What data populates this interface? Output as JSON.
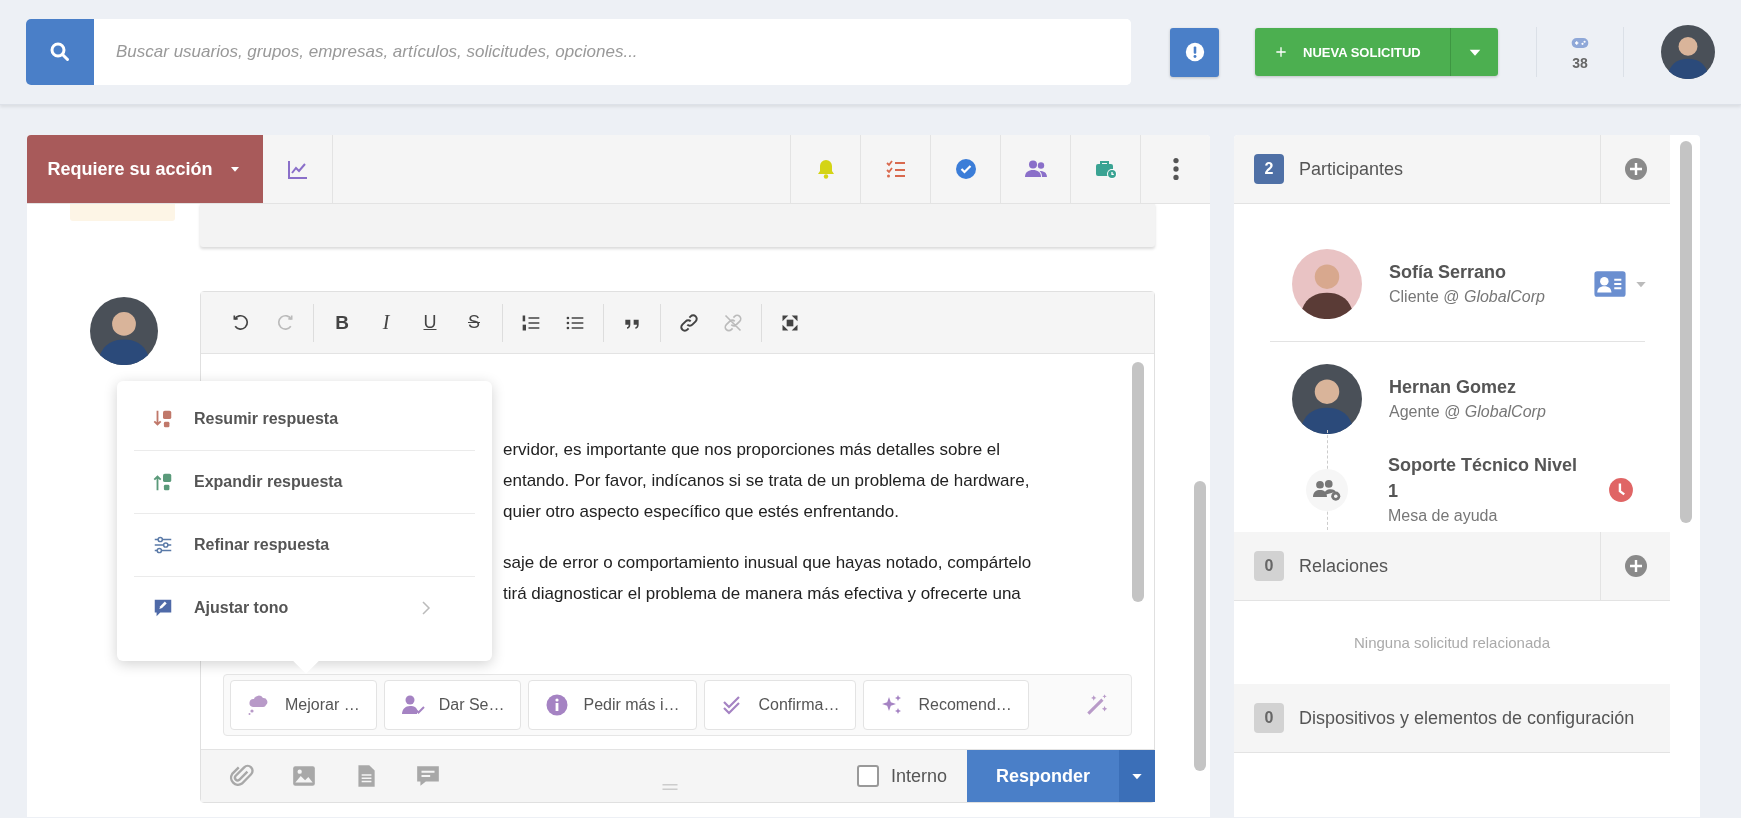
{
  "search": {
    "placeholder": "Buscar usuarios, grupos, empresas, artículos, solicitudes, opciones..."
  },
  "header": {
    "new_request": "NUEVA SOLICITUD",
    "counter": "38"
  },
  "ticket_toolbar": {
    "status": "Requiere su acción"
  },
  "editor": {
    "format_groups": [
      [
        {
          "kind": "undo",
          "disabled": false
        },
        {
          "kind": "redo",
          "disabled": true
        }
      ],
      [
        {
          "kind": "bold",
          "glyph": "B",
          "disabled": false
        },
        {
          "kind": "italic",
          "glyph": "I",
          "disabled": false
        },
        {
          "kind": "underline",
          "glyph": "U",
          "disabled": false
        },
        {
          "kind": "strike",
          "glyph": "S",
          "disabled": false
        }
      ],
      [
        {
          "kind": "ordered-list",
          "disabled": false
        },
        {
          "kind": "bullet-list",
          "disabled": false
        }
      ],
      [
        {
          "kind": "quote",
          "disabled": false
        }
      ],
      [
        {
          "kind": "link",
          "disabled": false
        },
        {
          "kind": "unlink",
          "disabled": true
        }
      ],
      [
        {
          "kind": "fullscreen",
          "disabled": false
        }
      ]
    ],
    "paragraphs": [
      [
        "ervidor, es importante que nos proporciones más detalles sobre el",
        "entando. Por favor, indícanos si se trata de un problema de hardware,",
        "quier otro aspecto específico que estés enfrentando."
      ],
      [
        "saje de error o comportamiento inusual que hayas notado, compártelo",
        "tirá diagnosticar el problema de manera más efectiva y ofrecerte una"
      ]
    ],
    "suggestions": [
      {
        "kind": "improve",
        "label": "Mejorar …"
      },
      {
        "kind": "follow-up",
        "label": "Dar Se…"
      },
      {
        "kind": "info",
        "label": "Pedir más i…"
      },
      {
        "kind": "confirm",
        "label": "Confirma…"
      },
      {
        "kind": "recommend",
        "label": "Recomend…"
      }
    ],
    "internal": {
      "label": "Interno",
      "checked": false
    },
    "send": "Responder"
  },
  "popup_menu": {
    "items": [
      {
        "kind": "summarize",
        "label": "Resumir respuesta",
        "submenu": false
      },
      {
        "kind": "expand",
        "label": "Expandir respuesta",
        "submenu": false
      },
      {
        "kind": "refine",
        "label": "Refinar respuesta",
        "submenu": false
      },
      {
        "kind": "tone",
        "label": "Ajustar tono",
        "submenu": true
      }
    ]
  },
  "sidebar": {
    "participants": {
      "count": "2",
      "color": "#4f70a6",
      "title": "Participantes",
      "people": [
        {
          "kind": "person",
          "name": "Sofía Serrano",
          "role": "Cliente @ *GlobalCorp*",
          "contact_card": true
        },
        {
          "kind": "person",
          "name": "Hernan Gomez",
          "role": "Agente @ *GlobalCorp*",
          "contact_card": false,
          "children": [
            {
              "kind": "group",
              "name": "Soporte Técnico Nivel 1",
              "role": "Mesa de ayuda",
              "pending": true
            }
          ]
        }
      ]
    },
    "relations": {
      "count": "0",
      "color": "#d2d2d2",
      "title": "Relaciones",
      "empty": "Ninguna solicitud relacionada"
    },
    "devices": {
      "count": "0",
      "color": "#d2d2d2",
      "title": "Dispositivos y elementos de configuración"
    }
  }
}
